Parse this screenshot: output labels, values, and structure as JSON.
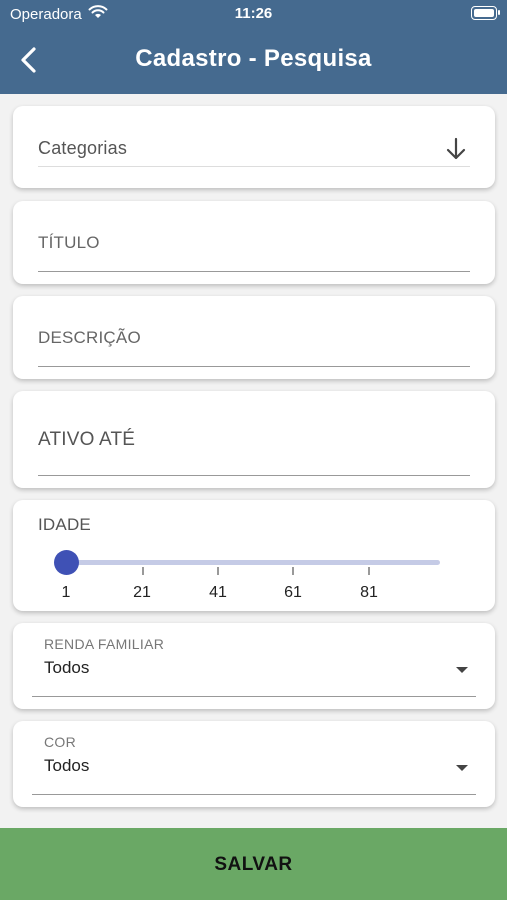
{
  "status_bar": {
    "carrier": "Operadora",
    "time": "11:26"
  },
  "header": {
    "title": "Cadastro - Pesquisa",
    "back_icon": "chevron-left-icon"
  },
  "form": {
    "categorias": {
      "label": "Categorias",
      "icon": "arrow-down-icon"
    },
    "titulo": {
      "label": "TÍTULO",
      "value": ""
    },
    "descricao": {
      "label": "DESCRIÇÃO",
      "value": ""
    },
    "ativo_ate": {
      "label": "ATIVO ATÉ",
      "value": ""
    },
    "idade": {
      "label": "IDADE",
      "value": 1,
      "ticks": [
        "1",
        "21",
        "41",
        "61",
        "81"
      ]
    },
    "renda_familiar": {
      "label": "RENDA FAMILIAR",
      "selected": "Todos"
    },
    "cor": {
      "label": "COR",
      "selected": "Todos"
    }
  },
  "save_button": {
    "label": "SALVAR"
  },
  "colors": {
    "header": "#456a8f",
    "slider": "#3f51b5",
    "save": "#6aa865"
  }
}
